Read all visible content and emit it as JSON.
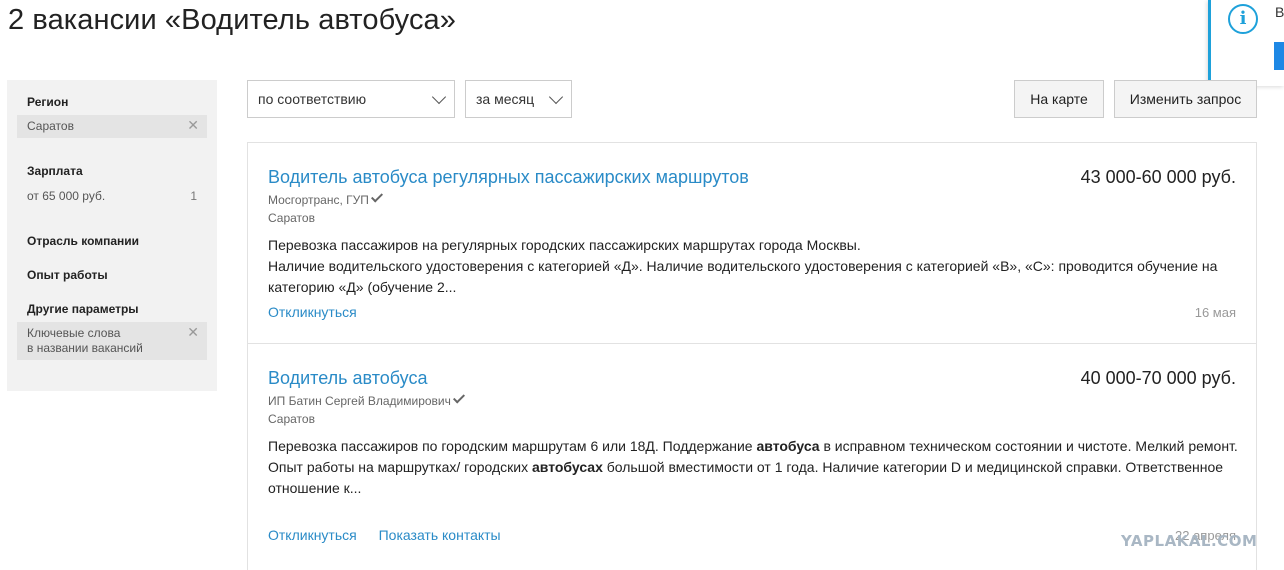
{
  "page": {
    "title": "2 вакансии «Водитель автобуса»"
  },
  "notification": {
    "icon": "info-icon",
    "text": "В"
  },
  "sidebar": {
    "region": {
      "title": "Регион",
      "chip": "Саратов"
    },
    "salary": {
      "title": "Зарплата",
      "option": "от 65 000 руб.",
      "count": "1"
    },
    "industry": {
      "title": "Отрасль компании"
    },
    "experience": {
      "title": "Опыт работы"
    },
    "other": {
      "title": "Другие параметры",
      "chip_line1": "Ключевые слова",
      "chip_line2": "в названии вакансий"
    }
  },
  "toolbar": {
    "sort_value": "по соответствию",
    "period_value": "за месяц",
    "map_button": "На карте",
    "change_button": "Изменить запрос"
  },
  "vacancies": [
    {
      "title": "Водитель автобуса регулярных пассажирских маршрутов",
      "salary": "43 000-60 000 руб.",
      "company": "Мосгортранс, ГУП",
      "city": "Саратов",
      "desc_line1": "Перевозка пассажиров на регулярных городских пассажирских маршрутах города Москвы.",
      "desc_line2": "Наличие водительского удостоверения с категорией «Д». Наличие водительского удостоверения с категорией «В», «С»: проводится обучение на категорию «Д» (обучение 2...",
      "respond": "Откликнуться",
      "date": "16 мая"
    },
    {
      "title": "Водитель автобуса",
      "salary": "40 000-70 000 руб.",
      "company": "ИП Батин Сергей Владимирович",
      "city": "Саратов",
      "desc_p1_a": "Перевозка пассажиров по городским маршрутам 6 или 18Д. Поддержание ",
      "desc_p1_bold": "автобуса",
      "desc_p1_b": " в исправном техническом состоянии и чистоте. Мелкий ремонт.",
      "desc_p2_a": "Опыт работы на маршрутках/ городских ",
      "desc_p2_bold": "автобусах",
      "desc_p2_b": " большой вместимости от 1 года. Наличие категории D и медицинской справки. Ответственное отношение к...",
      "respond": "Откликнуться",
      "contacts": "Показать контакты",
      "date": "22 апреля"
    }
  ],
  "watermark": "YAPLAKAL.COM"
}
